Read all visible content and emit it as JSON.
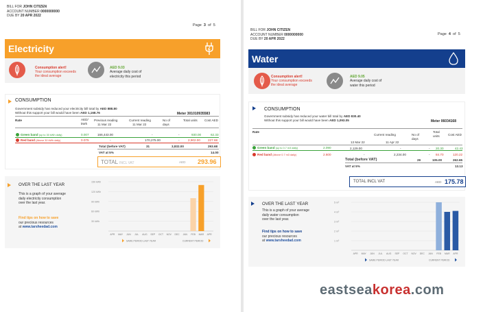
{
  "colors": {
    "electricity": "#f7a02a",
    "water": "#143f8d",
    "alert_red": "#d8392b",
    "green": "#5fa52f"
  },
  "left": {
    "header": {
      "bill_for_label": "BILL FOR",
      "bill_for": "JOHN CITIZEN",
      "account_label": "ACCOUNT NUMBER",
      "account": "0000000000",
      "due_label": "DUE BY",
      "due": "20 APR 2022"
    },
    "page": {
      "label": "Page",
      "current": "3",
      "of": "of",
      "total": "5"
    },
    "band_title": "Electricity",
    "band_icon": "plug-icon",
    "alert": {
      "title": "Consumption alert!",
      "line1": "Your consumption exceeds",
      "line2": "the ideal average"
    },
    "avg": {
      "value": "AED 9.03",
      "line1": "Average daily cost of",
      "line2": "electricity this period"
    },
    "consumption": {
      "title": "CONSUMPTION",
      "subsidy_line1_prefix": "Government subsidy has reduced your electricity bill total by",
      "subsidy_line1_amount": "AED 888.80",
      "subsidy_line2_prefix": "Without this support your bill would have been",
      "subsidy_line2_amount": "AED 1,168.76",
      "meter": "Meter 301010935583",
      "headers": {
        "rate": "Rate",
        "aed_kwh": "AED/ kWh",
        "previous": "Previous reading",
        "previous_date": "11 Mar 22",
        "current": "Current reading",
        "current_date": "11 Mar 22",
        "days": "No of days",
        "units": "Total units",
        "cost": "Cost AED"
      },
      "green_band": {
        "label": "Green band",
        "note": "(up to 30 kWh daily)",
        "rate": "0.007",
        "previous": "166,443.00",
        "current": "-",
        "days": "-",
        "units": "930.00",
        "cost": "62.33"
      },
      "red_band": {
        "label": "Red band",
        "note": "(Above 30 kWh daily)",
        "rate": "0.075",
        "previous": "-",
        "current": "170,275.00",
        "days": "-",
        "units": "2,902.00",
        "cost": "227.68"
      },
      "total_before_vat_label": "Total (before VAT)",
      "total_days": "31",
      "total_units": "3,832.00",
      "total_cost": "293.68",
      "vat_label": "VAT at 5%",
      "vat": "14.00",
      "total_incl_vat_label": "TOTAL",
      "total_incl_vat_sub": "INCL VAT",
      "total_currency": "AED",
      "total_incl_vat": "293.96"
    },
    "over": {
      "title": "OVER THE LAST YEAR",
      "text": [
        "This is a graph of your average",
        "daily electricity consumption",
        "over the last year."
      ],
      "tips_title": "Find tips on how to save",
      "tips_line": "our precious resources",
      "tips_at": "at",
      "tips_link": "www.tarsheedad.com"
    },
    "chart_data": {
      "type": "bar",
      "categories": [
        "APR",
        "MAY",
        "JUN",
        "JUL",
        "AUG",
        "SEP",
        "OCT",
        "NOV",
        "DEC",
        "JAN",
        "FEB",
        "MAR",
        "APR"
      ],
      "values": [
        0,
        0,
        0,
        0,
        0,
        0,
        0,
        0,
        0,
        0,
        100,
        140,
        0
      ],
      "yticks": [
        "150 kWh",
        "120 kWh",
        "90 kWh",
        "60 kWh",
        "30 kWh"
      ],
      "ylim": [
        0,
        150
      ],
      "legend": [
        "SAME PERIOD LAST YEAR",
        "CURRENT PERIOD"
      ],
      "colors": {
        "last_year": "#fbd3a7",
        "current": "#f7a02a"
      }
    }
  },
  "right": {
    "header": {
      "bill_for_label": "BILL FOR",
      "bill_for": "JOHN CITIZEN",
      "account_label": "ACCOUNT NUMBER",
      "account": "0000000000",
      "due_label": "DUE BY",
      "due": "20 APR 2022"
    },
    "page": {
      "label": "Page",
      "current": "4",
      "of": "of",
      "total": "5"
    },
    "band_title": "Water",
    "band_icon": "water-drop-icon",
    "alert": {
      "title": "Consumption alert!",
      "line1": "Your consumption exceeds",
      "line2": "the ideal average"
    },
    "avg": {
      "value": "AED 9.05",
      "line1": "Average daily cost of",
      "line2": "water this period"
    },
    "consumption": {
      "title": "CONSUMPTION",
      "subsidy_line1_prefix": "Government subsidy has reduced your water bill total by",
      "subsidy_line1_amount": "AED 830.40",
      "subsidy_line2_prefix": "Without this support your bill would have been",
      "subsidy_line2_amount": "AED 1,093.05",
      "meter": "Meter 06034168",
      "headers": {
        "rate": "Rate",
        "current": "Current reading",
        "current_date": "11 Apr 22",
        "previous_date": "13 Mar 22",
        "days": "No of days",
        "units": "Total units",
        "cost": "Cost AED"
      },
      "green_band": {
        "label": "Green band",
        "note": "(up to 0.7 m3 daily)",
        "rate": "2.090",
        "previous": "2,129.00",
        "current": "-",
        "days": "-",
        "units": "20.30",
        "cost": "42.43"
      },
      "red_band": {
        "label": "Red band",
        "note": "(Above 0.7 m3 daily)",
        "rate": "2.600",
        "previous": "-",
        "current": "2,234.00",
        "days": "-",
        "units": "84.70",
        "cost": "120.22"
      },
      "total_before_vat_label": "Total (before VAT)",
      "total_days": "29",
      "total_units": "105.00",
      "total_cost": "262.65",
      "vat_label": "VAT at 5%",
      "vat": "13.13",
      "total_incl_vat_label": "TOTAL INCL VAT",
      "total_currency": "AED",
      "total_incl_vat": "175.78"
    },
    "over": {
      "title": "OVER THE LAST YEAR",
      "text": [
        "This is a graph of your average",
        "daily water consumption",
        "over the last year."
      ],
      "tips_title": "Find tips on how to save",
      "tips_line": "our precious resources",
      "tips_at": "at",
      "tips_link": "www.tarsheedad.com"
    },
    "chart_data": {
      "type": "bar",
      "categories": [
        "APR",
        "MAY",
        "JUN",
        "JUL",
        "AUG",
        "SEP",
        "OCT",
        "NOV",
        "DEC",
        "JAN",
        "FEB",
        "MAR",
        "APR"
      ],
      "values": [
        0,
        0,
        0,
        0,
        0,
        0,
        0,
        0,
        0,
        0,
        5,
        4,
        4.1
      ],
      "yticks": [
        "5 m³",
        "4 m³",
        "3 m³",
        "2 m³",
        "1 m³"
      ],
      "ylim": [
        0,
        5
      ],
      "legend": [
        "SAME PERIOD LAST YEAR",
        "CURRENT PERIOD"
      ],
      "colors": {
        "last_year": "#8fb0dc",
        "current": "#2a5aa5"
      }
    }
  },
  "watermark": {
    "part1": "eastsea",
    "part2": "korea",
    "part3": ".com"
  }
}
